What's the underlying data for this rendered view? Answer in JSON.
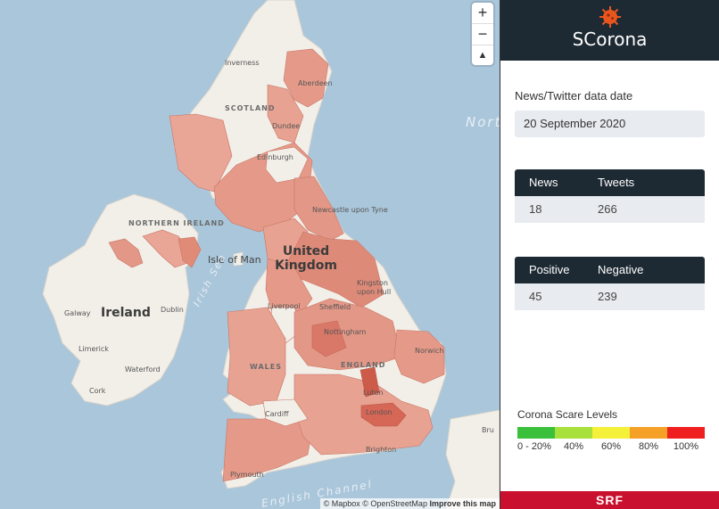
{
  "map": {
    "zoom_in": "+",
    "zoom_out": "−",
    "compass": "▲",
    "attribution": "© Mapbox © OpenStreetMap",
    "improve": "Improve this map",
    "labels": {
      "inverness": "Inverness",
      "aberdeen": "Aberdeen",
      "scotland": "SCOTLAND",
      "dundee": "Dundee",
      "edinburgh": "Edinburgh",
      "newcastle": "Newcastle upon Tyne",
      "northern_ireland": "NORTHERN IRELAND",
      "isle_of_man": "Isle of Man",
      "united_kingdom": "United Kingdom",
      "kingston": "Kingston upon Hull",
      "liverpool": "Liverpool",
      "sheffield": "Sheffield",
      "galway": "Galway",
      "ireland": "Ireland",
      "dublin": "Dublin",
      "irish_sea": "Irish Sea",
      "nottingham": "Nottingham",
      "norwich": "Norwich",
      "limerick": "Limerick",
      "wales": "WALES",
      "england": "ENGLAND",
      "waterford": "Waterford",
      "cork": "Cork",
      "luton": "Luton",
      "cardiff": "Cardiff",
      "london": "London",
      "brighton": "Brighton",
      "plymouth": "Plymouth",
      "english_channel": "English Channel",
      "north_sea": "North Sea",
      "bru": "Bru"
    }
  },
  "panel": {
    "title": "SCorona",
    "date_label": "News/Twitter data date",
    "date_value": "20 September 2020",
    "counts": {
      "col1": "News",
      "col2": "Tweets",
      "val1": "18",
      "val2": "266"
    },
    "sentiment": {
      "col1": "Positive",
      "col2": "Negative",
      "val1": "45",
      "val2": "239"
    },
    "legend": {
      "title": "Corona Scare Levels",
      "colors": [
        "#3bc03b",
        "#a8e03c",
        "#f5f03a",
        "#f5a027",
        "#f01f1f"
      ],
      "ticks": [
        "0 - 20%",
        "40%",
        "60%",
        "80%",
        "100%"
      ]
    },
    "footer": "SRF"
  }
}
